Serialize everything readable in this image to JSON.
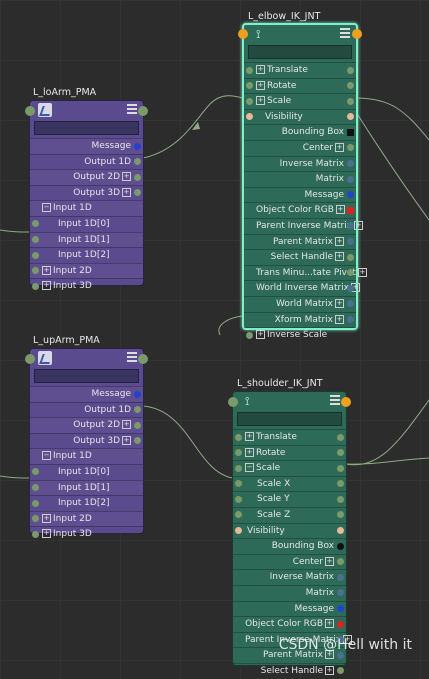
{
  "colors": {
    "pma_node": "#5a4a8e",
    "jnt_node": "#2e6a58",
    "selected_outline": "#7ef0c8",
    "plug_gray": "#7a9a6a",
    "plug_blue": "#2244cc",
    "plug_peach": "#e8b898",
    "plug_orange": "#f0a020",
    "plug_steel": "#4a7090",
    "plug_black": "#111111",
    "plug_red": "#dd2222",
    "wire": "#8faa88"
  },
  "nodes": {
    "loArm": {
      "title": "L_loArm_PMA",
      "rows": [
        "Message",
        "Output 1D",
        "Output 2D",
        "Output 3D",
        "Input 1D",
        "Input 1D[0]",
        "Input 1D[1]",
        "Input 1D[2]",
        "Input 2D",
        "Input 3D"
      ]
    },
    "upArm": {
      "title": "L_upArm_PMA",
      "rows": [
        "Message",
        "Output 1D",
        "Output 2D",
        "Output 3D",
        "Input 1D",
        "Input 1D[0]",
        "Input 1D[1]",
        "Input 1D[2]",
        "Input 2D",
        "Input 3D"
      ]
    },
    "elbow": {
      "title": "L_elbow_IK_JNT",
      "rows_left": [
        "Translate",
        "Rotate",
        "Scale",
        "Visibility"
      ],
      "rows_right": [
        "Bounding Box",
        "Center",
        "Inverse Matrix",
        "Matrix",
        "Message",
        "Object Color RGB",
        "Parent Inverse Matrix",
        "Parent Matrix",
        "Select Handle",
        "Trans Minu...tate Pivot",
        "World Inverse Matrix",
        "World Matrix",
        "Xform Matrix"
      ],
      "bottom_row": "Inverse Scale"
    },
    "shoulder": {
      "title": "L_shoulder_IK_JNT",
      "rows_left": [
        "Translate",
        "Rotate",
        "Scale",
        "Scale X",
        "Scale Y",
        "Scale Z",
        "Visibility"
      ],
      "rows_right": [
        "Bounding Box",
        "Center",
        "Inverse Matrix",
        "Matrix",
        "Message",
        "Object Color RGB",
        "Parent Inverse Matrix",
        "Parent Matrix",
        "Select Handle"
      ]
    }
  },
  "watermark": "CSDN @Hell with it"
}
